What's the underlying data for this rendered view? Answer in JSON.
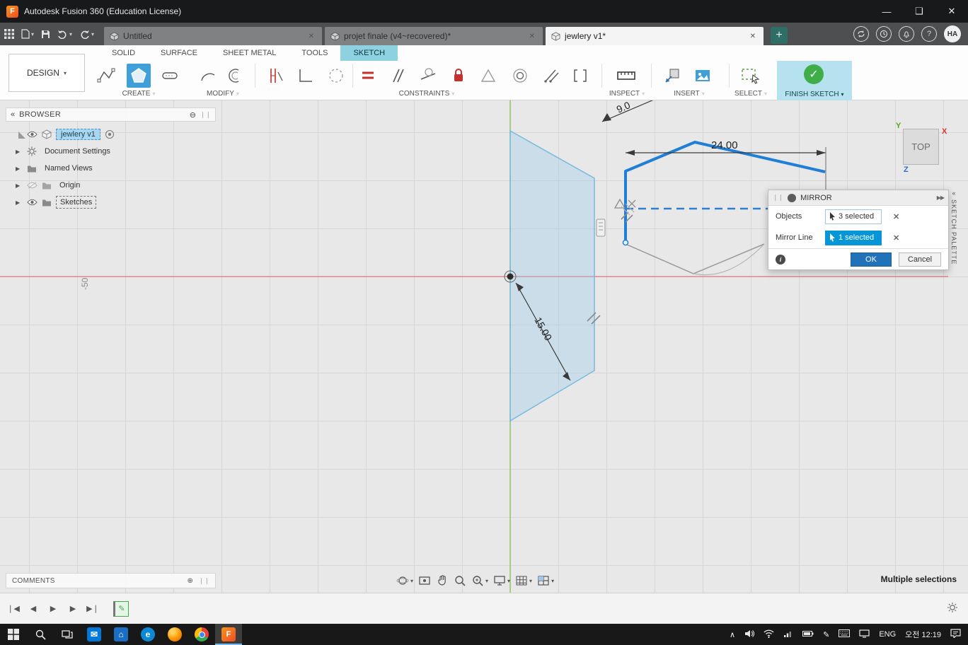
{
  "colors": {
    "fusion_orange": "#f0841e",
    "accent_blue": "#0696d7",
    "selection_blue": "#1f7ed6",
    "ok_blue": "#2272b9",
    "finish_green": "#3fae49",
    "sketch_tab_cyan": "#8ed2e2",
    "axis_red": "#e05a5a",
    "axis_green": "#76c043"
  },
  "icons": {
    "caret": "▾",
    "minimize": "—",
    "maximize": "❑",
    "close": "✕",
    "tab_close": "✕",
    "plus": "+",
    "circle_plus": "⊕",
    "circle_minus": "⊖",
    "collapse_left": "«",
    "fast_forward": "▶▶",
    "grip": "❘❘",
    "expander": "▶",
    "help": "?",
    "info": "i",
    "clear": "✕",
    "chevron_up": "∧",
    "skip_start": "❘◀",
    "step_back": "◀",
    "play": "▶",
    "step_forward": "▶",
    "skip_end": "▶❘",
    "gear": "⚙",
    "pen": "✎"
  },
  "window": {
    "title": "Autodesk Fusion 360 (Education License)"
  },
  "tabs": {
    "items": [
      {
        "label": "Untitled"
      },
      {
        "label": "projet finale (v4~recovered)*"
      },
      {
        "label": "jewlery v1*"
      }
    ],
    "avatar": "HA"
  },
  "ribbon": {
    "design": "DESIGN",
    "workspace_tabs": {
      "solid": "SOLID",
      "surface": "SURFACE",
      "sheet_metal": "SHEET METAL",
      "tools": "TOOLS",
      "sketch": "SKETCH"
    },
    "groups": {
      "create": "CREATE",
      "modify": "MODIFY",
      "constraints": "CONSTRAINTS",
      "inspect": "INSPECT",
      "insert": "INSERT",
      "select": "SELECT",
      "finish": "FINISH SKETCH"
    }
  },
  "browser": {
    "title": "BROWSER",
    "root_label": "jewlery v1",
    "items": [
      {
        "label": "Document Settings"
      },
      {
        "label": "Named Views"
      },
      {
        "label": "Origin"
      },
      {
        "label": "Sketches"
      }
    ]
  },
  "viewcube": {
    "face": "TOP",
    "axis_x": "X",
    "axis_y": "Y",
    "axis_z": "Z"
  },
  "sketch_palette": {
    "title": "SKETCH PALETTE"
  },
  "mirror_dialog": {
    "title": "MIRROR",
    "rows": [
      {
        "label": "Objects",
        "value": "3 selected"
      },
      {
        "label": "Mirror Line",
        "value": "1 selected"
      }
    ],
    "ok": "OK",
    "cancel": "Cancel"
  },
  "sketch": {
    "dim_width": "24.00",
    "dim_length": "15.00",
    "dim_partial": "9.0",
    "grid_coord": "-50"
  },
  "bottom_bar": {
    "comments": "COMMENTS",
    "status": "Multiple selections"
  },
  "taskbar": {
    "language": "ENG",
    "time": "오전 12:19"
  }
}
